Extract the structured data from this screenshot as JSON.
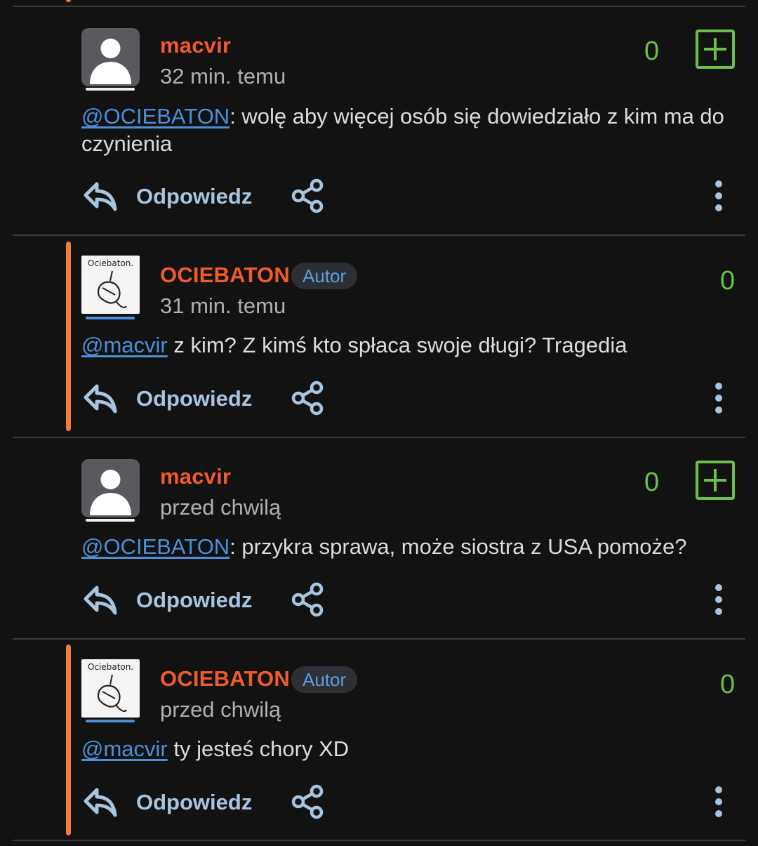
{
  "colors": {
    "background": "#121212",
    "username": "#f05b2b",
    "mention": "#4a90d9",
    "score": "#6cbf4a",
    "action": "#a9c4de",
    "reply_bar": "#f07b3f",
    "badge_bg": "#2c2f33",
    "badge_text": "#5b9fe0"
  },
  "actions": {
    "reply_label": "Odpowiedz",
    "reply_icon": "reply-arrow-icon",
    "share_icon": "share-icon",
    "more_icon": "more-vertical-icon"
  },
  "comments": [
    {
      "username": "macvir",
      "time": "32 min. temu",
      "score": "0",
      "mention": "@OCIEBATON",
      "text": ": wolę aby więcej osób się dowiedziało z kim ma do czynienia",
      "avatar": "default-user-avatar",
      "can_vote": true
    },
    {
      "username": "OCIEBATON",
      "badge": "Autor",
      "time": "31 min. temu",
      "score": "0",
      "mention": "@macvir",
      "text": " z kim? Z kimś kto spłaca swoje długi? Tragedia",
      "avatar_caption": "Ociebaton.",
      "can_vote": false
    },
    {
      "username": "macvir",
      "time": "przed chwilą",
      "score": "0",
      "mention": "@OCIEBATON",
      "text": ": przykra sprawa, może siostra z USA pomoże?",
      "avatar": "default-user-avatar",
      "can_vote": true
    },
    {
      "username": "OCIEBATON",
      "badge": "Autor",
      "time": "przed chwilą",
      "score": "0",
      "mention": "@macvir",
      "text": " ty jesteś chory XD",
      "avatar_caption": "Ociebaton.",
      "can_vote": false
    }
  ]
}
